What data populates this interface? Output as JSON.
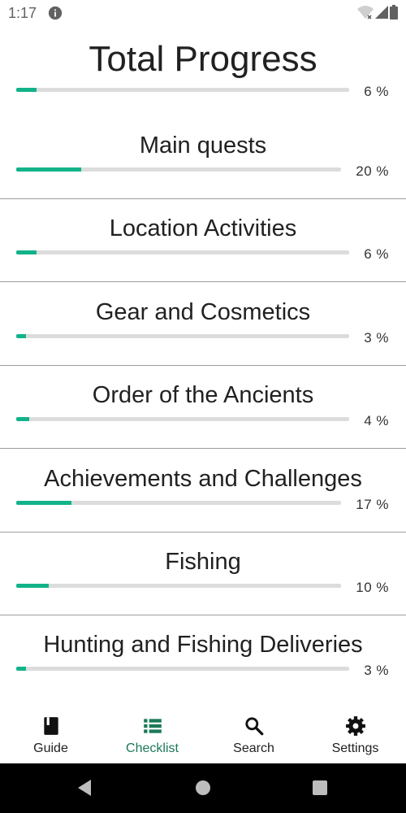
{
  "status_bar": {
    "time": "1:17",
    "icons": [
      "info-icon",
      "wifi-icon",
      "signal-icon",
      "battery-icon"
    ]
  },
  "total": {
    "title": "Total Progress",
    "progress": 6,
    "percent_label": "6 %"
  },
  "categories": [
    {
      "title": "Main quests",
      "progress": 20,
      "percent_label": "20 %"
    },
    {
      "title": "Location Activities",
      "progress": 6,
      "percent_label": "6 %"
    },
    {
      "title": "Gear and Cosmetics",
      "progress": 3,
      "percent_label": "3 %"
    },
    {
      "title": "Order of the Ancients",
      "progress": 4,
      "percent_label": "4 %"
    },
    {
      "title": "Achievements and Challenges",
      "progress": 17,
      "percent_label": "17 %"
    },
    {
      "title": "Fishing",
      "progress": 10,
      "percent_label": "10 %"
    },
    {
      "title": "Hunting and Fishing Deliveries",
      "progress": 3,
      "percent_label": "3 %"
    }
  ],
  "bottom_nav": [
    {
      "label": "Guide",
      "icon": "book-icon",
      "active": false
    },
    {
      "label": "Checklist",
      "icon": "checklist-icon",
      "active": true
    },
    {
      "label": "Search",
      "icon": "search-icon",
      "active": false
    },
    {
      "label": "Settings",
      "icon": "gear-icon",
      "active": false
    }
  ],
  "colors": {
    "accent": "#12b38a",
    "active_nav": "#1b7a58",
    "track": "#dcdcdc"
  }
}
